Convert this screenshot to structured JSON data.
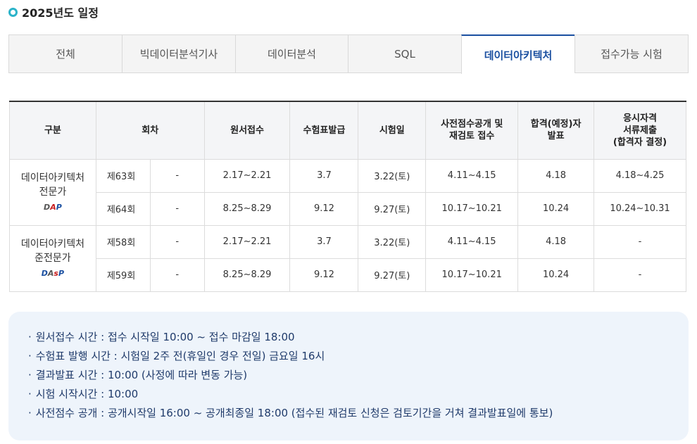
{
  "header": {
    "title": "2025년도 일정"
  },
  "tabs": [
    {
      "label": "전체",
      "active": false
    },
    {
      "label": "빅데이터분석기사",
      "active": false
    },
    {
      "label": "데이터분석",
      "active": false
    },
    {
      "label": "SQL",
      "active": false
    },
    {
      "label": "데이터아키텍처",
      "active": true
    },
    {
      "label": "접수가능 시험",
      "active": false
    }
  ],
  "table": {
    "headers": {
      "grade": "구분",
      "round": "회차",
      "application": "원서접수",
      "ticket": "수험표발급",
      "exam_date": "시험일",
      "pre_score": "사전점수공개 및\n재검토 접수",
      "result": "합격(예정)자\n발표",
      "documents": "응시자격\n서류제출\n(합격자 결정)"
    },
    "groups": [
      {
        "grade_line1": "데이터아키텍처",
        "grade_line2": "전문가",
        "logo_text": "DAP",
        "rows": [
          {
            "round": "제63회",
            "extra": "-",
            "application": "2.17~2.21",
            "ticket": "3.7",
            "exam_date": "3.22(토)",
            "pre_score": "4.11~4.15",
            "result": "4.18",
            "documents": "4.18~4.25"
          },
          {
            "round": "제64회",
            "extra": "-",
            "application": "8.25~8.29",
            "ticket": "9.12",
            "exam_date": "9.27(토)",
            "pre_score": "10.17~10.21",
            "result": "10.24",
            "documents": "10.24~10.31"
          }
        ]
      },
      {
        "grade_line1": "데이터아키텍처",
        "grade_line2": "준전문가",
        "logo_text": "DAsP",
        "rows": [
          {
            "round": "제58회",
            "extra": "-",
            "application": "2.17~2.21",
            "ticket": "3.7",
            "exam_date": "3.22(토)",
            "pre_score": "4.11~4.15",
            "result": "4.18",
            "documents": "-"
          },
          {
            "round": "제59회",
            "extra": "-",
            "application": "8.25~8.29",
            "ticket": "9.12",
            "exam_date": "9.27(토)",
            "pre_score": "10.17~10.21",
            "result": "10.24",
            "documents": "-"
          }
        ]
      }
    ]
  },
  "notice": {
    "bullet": "·",
    "items": [
      "원서접수 시간 : 접수 시작일 10:00 ~ 접수 마감일 18:00",
      "수험표 발행 시간 : 시험일 2주 전(휴일인 경우 전일) 금요일 16시",
      "결과발표 시간 : 10:00 (사정에 따라 변동 가능)",
      "시험 시작시간 : 10:00",
      "사전점수 공개 : 공개시작일 16:00 ~ 공개최종일 18:00 (접수된 재검토 신청은 검토기간을 거쳐 결과발표일에 통보)"
    ]
  },
  "colors": {
    "accent": "#1a4fa0",
    "title_dot": "#2bb3c9",
    "notice_bg": "#eef4fb"
  }
}
